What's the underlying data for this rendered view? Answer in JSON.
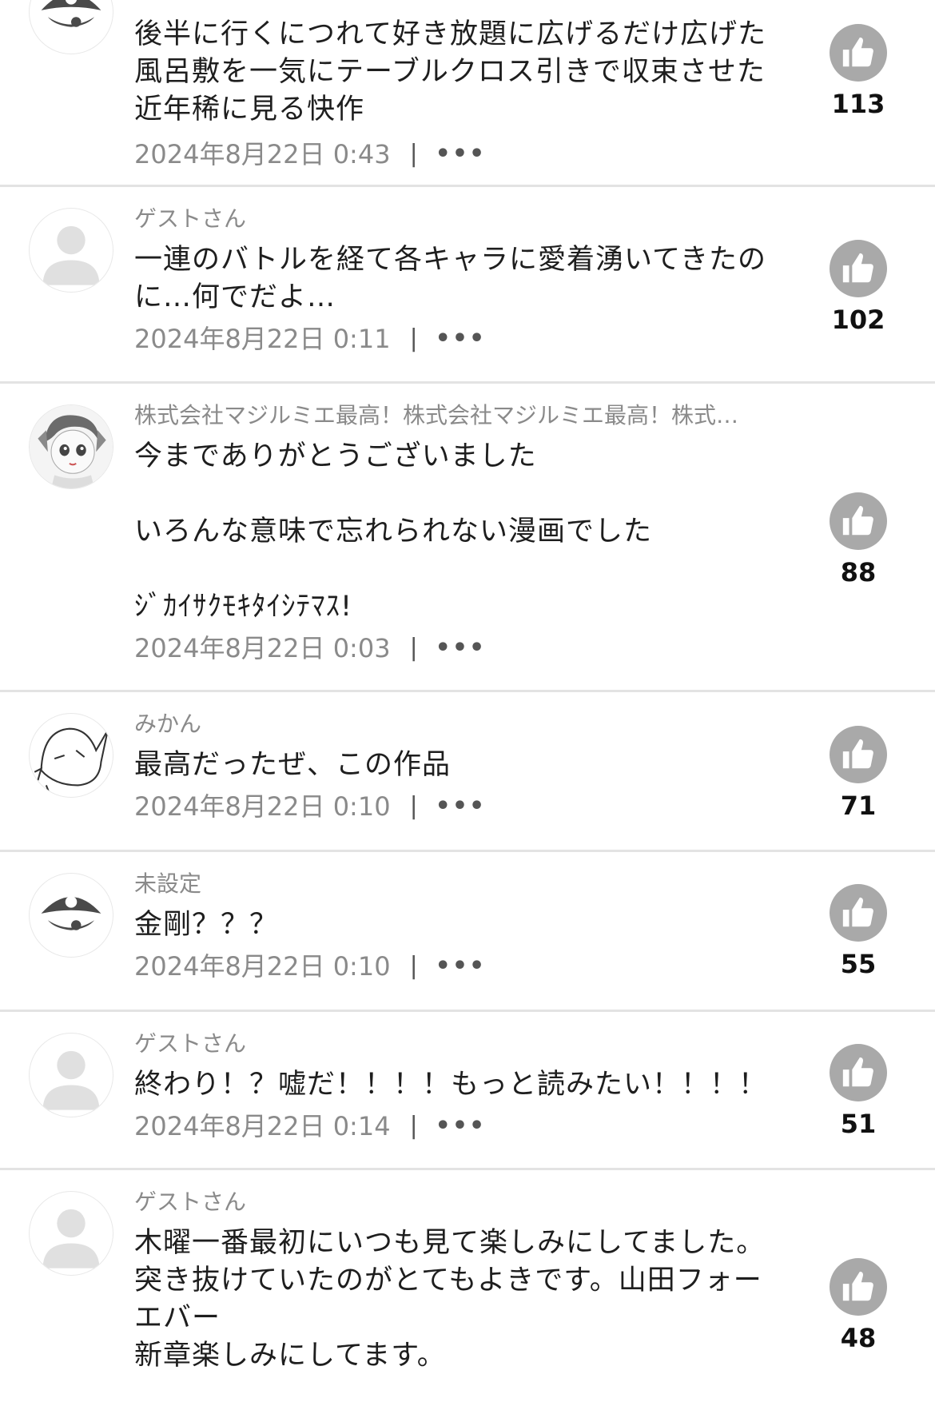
{
  "comments": [
    {
      "username": "",
      "avatar": "pirate-icon",
      "text": "後半に行くにつれて好き放題に広げるだけ広げた\n風呂敷を一気にテーブルクロス引きで収束させた\n近年稀に見る快作",
      "date": "2024年8月22日 0:43",
      "likes": "113"
    },
    {
      "username": "ゲストさん",
      "avatar": "default-user-icon",
      "text": "一連のバトルを経て各キャラに愛着湧いてきたの\nに…何でだよ…",
      "date": "2024年8月22日 0:11",
      "likes": "102"
    },
    {
      "username": "株式会社マジルミエ最高！株式会社マジルミエ最高！株式…",
      "avatar": "manga-girl-avatar",
      "text": "今までありがとうございました\n\nいろんな意味で忘れられない漫画でした\n\nｼﾞｶｲｻｸﾓｷﾀｲｼﾃﾏｽ!",
      "date": "2024年8月22日 0:03",
      "likes": "88"
    },
    {
      "username": "みかん",
      "avatar": "sketch-face-avatar",
      "text": "最高だったぜ、この作品",
      "date": "2024年8月22日 0:10",
      "likes": "71"
    },
    {
      "username": "未設定",
      "avatar": "pirate-icon",
      "text": "金剛？？？",
      "date": "2024年8月22日 0:10",
      "likes": "55"
    },
    {
      "username": "ゲストさん",
      "avatar": "default-user-icon",
      "text": "終わり！？嘘だ！！！！もっと読みたい！！！！",
      "date": "2024年8月22日 0:14",
      "likes": "51"
    },
    {
      "username": "ゲストさん",
      "avatar": "default-user-icon",
      "text": "木曜一番最初にいつも見て楽しみにしてました。\n突き抜けていたのがとてもよきです。山田フォー\nエバー\n新章楽しみにしてます。",
      "date": "",
      "likes": "48"
    }
  ],
  "meta": {
    "separator": "|",
    "more": "•••"
  }
}
